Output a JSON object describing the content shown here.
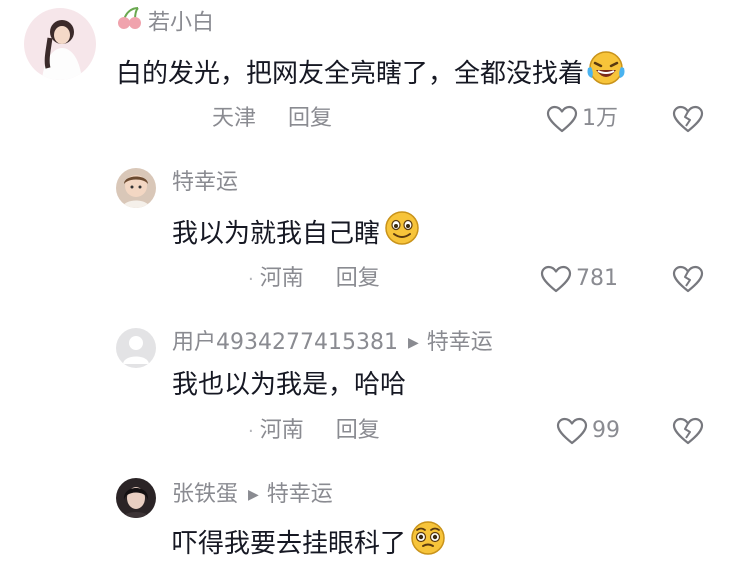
{
  "comments": [
    {
      "username": "若小白",
      "text": "白的发光，把网友全亮瞎了，全都没找着",
      "emoji": "crying-laughing-emoji",
      "location": "天津",
      "reply_label": "回复",
      "likes": "1万"
    },
    {
      "username": "特幸运",
      "text": "我以为就我自己瞎",
      "emoji": "smiling-emoji",
      "location": "河南",
      "reply_label": "回复",
      "likes": "781"
    },
    {
      "username": "用户4934277415381",
      "reply_to": "特幸运",
      "text": "我也以为我是，哈哈",
      "location": "河南",
      "reply_label": "回复",
      "likes": "99"
    },
    {
      "username": "张铁蛋",
      "reply_to": "特幸运",
      "text": "吓得我要去挂眼科了",
      "emoji": "pleading-emoji"
    }
  ],
  "colors": {
    "primary_text": "#161823",
    "secondary_text": "#8a8b91",
    "emoji_yellow": "#f7c43a"
  }
}
